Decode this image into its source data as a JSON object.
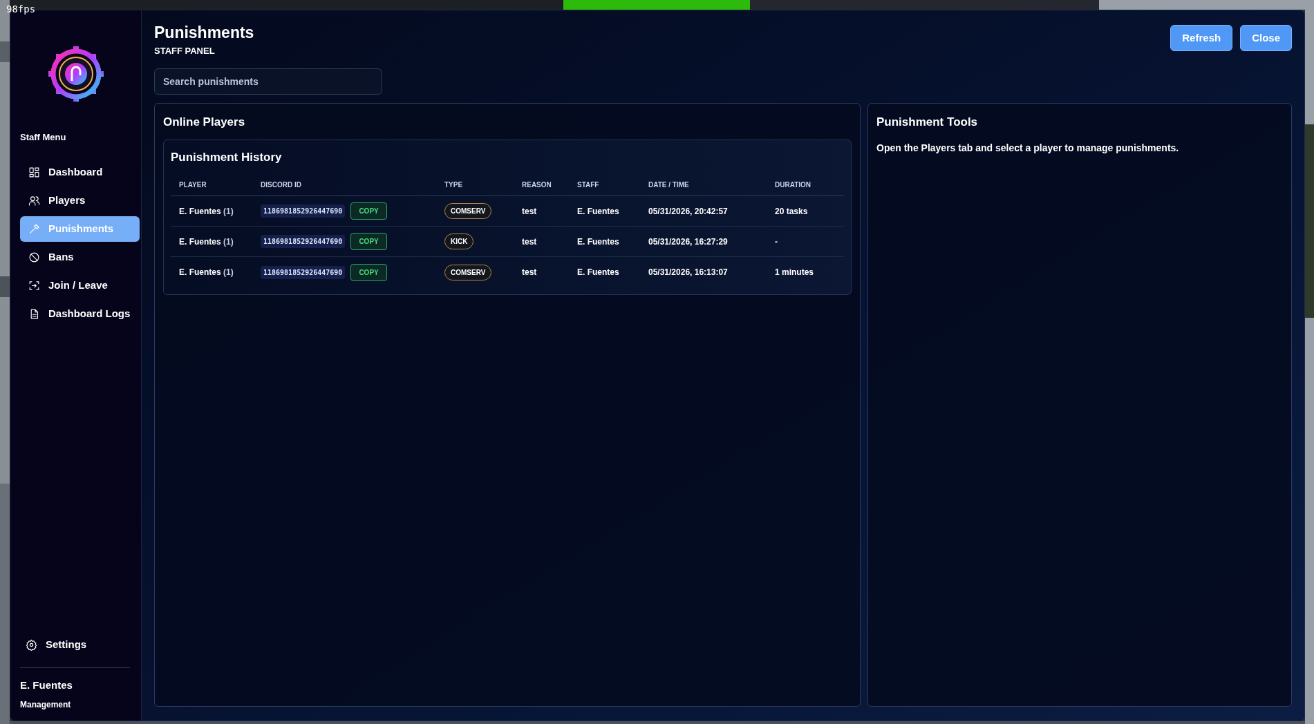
{
  "overlay": {
    "fps": "98fps"
  },
  "sidebar": {
    "heading": "Staff Menu",
    "items": [
      {
        "label": "Dashboard",
        "selected": false
      },
      {
        "label": "Players",
        "selected": false
      },
      {
        "label": "Punishments",
        "selected": true
      },
      {
        "label": "Bans",
        "selected": false
      },
      {
        "label": "Join / Leave",
        "selected": false
      },
      {
        "label": "Dashboard Logs",
        "selected": false
      }
    ],
    "footer_item": {
      "label": "Settings"
    },
    "user": {
      "name": "E. Fuentes",
      "role": "Management"
    }
  },
  "header": {
    "title": "Punishments",
    "subtitle": "STAFF PANEL",
    "buttons": [
      "Refresh",
      "Close"
    ]
  },
  "search": {
    "placeholder": "Search punishments"
  },
  "online_players": {
    "title": "Online Players",
    "history": {
      "title": "Punishment History",
      "columns": [
        "PLAYER",
        "DISCORD ID",
        "TYPE",
        "REASON",
        "STAFF",
        "DATE / TIME",
        "DURATION"
      ],
      "rows": [
        {
          "player": "E. Fuentes",
          "count": "(1)",
          "discord_id": "1186981852926447690",
          "copy": "COPY",
          "type": "COMSERV",
          "reason": "test",
          "staff": "E. Fuentes",
          "date": "05/31/2026, 20:42:57",
          "duration": "20 tasks"
        },
        {
          "player": "E. Fuentes",
          "count": "(1)",
          "discord_id": "1186981852926447690",
          "copy": "COPY",
          "type": "KICK",
          "reason": "test",
          "staff": "E. Fuentes",
          "date": "05/31/2026, 16:27:29",
          "duration": "-"
        },
        {
          "player": "E. Fuentes",
          "count": "(1)",
          "discord_id": "1186981852926447690",
          "copy": "COPY",
          "type": "COMSERV",
          "reason": "test",
          "staff": "E. Fuentes",
          "date": "05/31/2026, 16:13:07",
          "duration": "1 minutes"
        }
      ]
    }
  },
  "tools": {
    "title": "Punishment Tools",
    "message": "Open the Players tab and select a player to manage punishments."
  }
}
